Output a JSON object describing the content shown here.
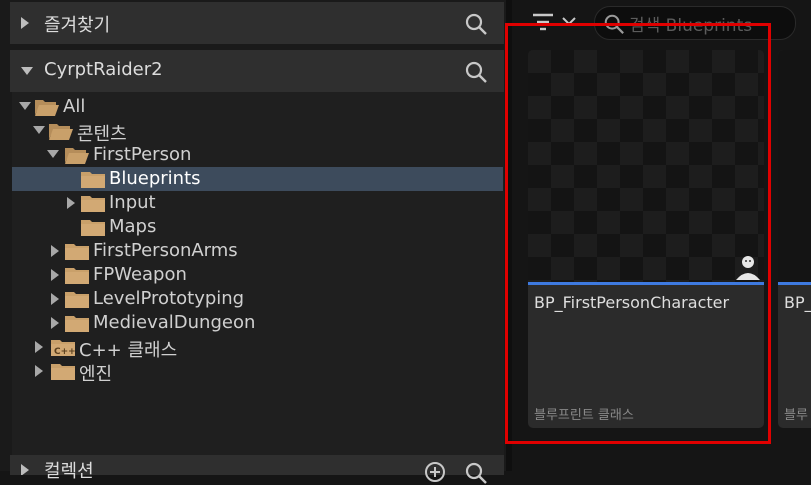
{
  "favorites": {
    "title": "즐겨찾기"
  },
  "project": {
    "title": "CyrptRaider2"
  },
  "tree": [
    {
      "label": "All",
      "expanded": true
    },
    {
      "label": "콘텐츠",
      "expanded": true
    },
    {
      "label": "FirstPerson",
      "expanded": true
    },
    {
      "label": "Blueprints",
      "selected": true
    },
    {
      "label": "Input",
      "expanded": false
    },
    {
      "label": "Maps"
    },
    {
      "label": "FirstPersonArms",
      "expanded": false
    },
    {
      "label": "FPWeapon",
      "expanded": false
    },
    {
      "label": "LevelPrototyping",
      "expanded": false
    },
    {
      "label": "MedievalDungeon",
      "expanded": false
    },
    {
      "label": "C++ 클래스",
      "expanded": false
    },
    {
      "label": "엔진",
      "expanded": false
    }
  ],
  "collections": {
    "title": "컬렉션"
  },
  "search": {
    "placeholder": "검색 Blueprints"
  },
  "assets": [
    {
      "name": "BP_FirstPersonCharacter",
      "type": "블루프린트 클래스"
    },
    {
      "name": "BP_",
      "type": "블루"
    }
  ],
  "colors": {
    "selection": "#3d4b5c",
    "accent_bar": "#3e7ae0",
    "highlight_box": "#e00000",
    "folder": "#c9a06a"
  }
}
